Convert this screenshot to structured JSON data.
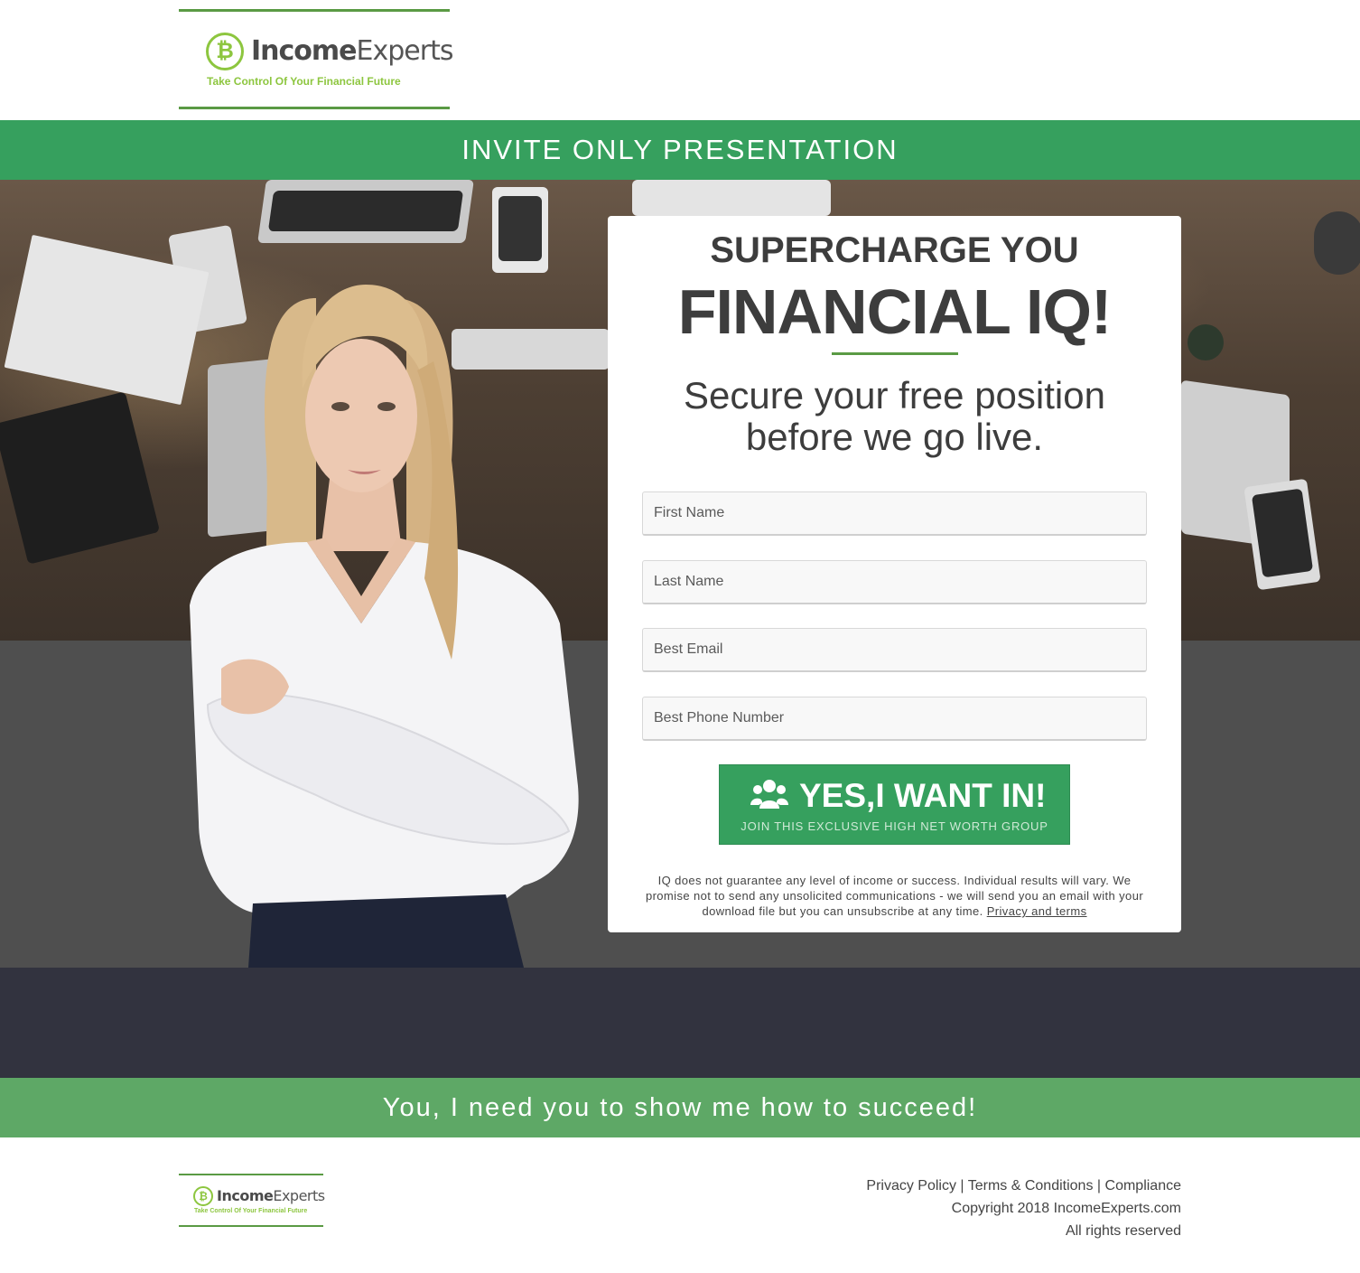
{
  "brand": {
    "name_bold": "Income",
    "name_regular": "Experts",
    "coin_symbol": "₿",
    "tagline": "Take Control Of Your Financial Future",
    "accent_color": "#5a9a44",
    "coin_color": "#8dc63f"
  },
  "banner_top": {
    "text": "INVITE ONLY PRESENTATION",
    "color": "#36a05e"
  },
  "card": {
    "headline_1": "SUPERCHARGE YOU",
    "headline_2": "FINANCIAL IQ!",
    "subheadline_line1": "Secure your free position",
    "subheadline_line2": "before we go live.",
    "fields": {
      "first_name_placeholder": "First Name",
      "last_name_placeholder": "Last Name",
      "email_placeholder": "Best Email",
      "phone_placeholder": "Best Phone Number"
    },
    "cta": {
      "icon": "users-group-icon",
      "label": "YES,I WANT IN!",
      "sublabel": "JOIN THIS EXCLUSIVE HIGH NET WORTH GROUP"
    },
    "disclaimer": "IQ does not guarantee any level of income or success. Individual results will vary. We promise not to send any unsolicited communications - we will send you an email with your download file but you can unsubscribe at any time.",
    "privacy_link": "Privacy and terms"
  },
  "banner_bottom": {
    "text": "You, I need you to show me how to succeed!",
    "color": "#5ea866"
  },
  "footer": {
    "links": [
      "Privacy Policy",
      "Terms & Conditions",
      "Compliance"
    ],
    "separator": "|",
    "copyright": "Copyright 2018 IncomeExperts.com",
    "rights": "All rights reserved"
  }
}
